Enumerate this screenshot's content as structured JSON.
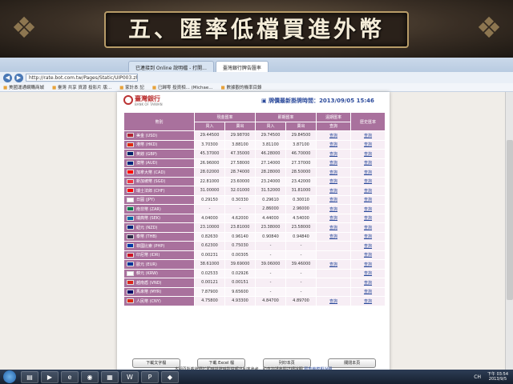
{
  "slide": {
    "title": "五、匯率低檔買進外幣"
  },
  "browser": {
    "tabs": [
      {
        "label": "已連接到 Online 說明檔 - 打開...",
        "active": false
      },
      {
        "label": "臺灣銀行牌告匯率",
        "active": true
      }
    ],
    "url": "http://rate.bot.com.tw/Pages/Static/UIP003.zh-TW.htm",
    "favorites": [
      "美國運通網購商城",
      "臺灣 共享 資源 投影片 版...",
      "家計本 記",
      "已歸零 投資相... (Michae...",
      "數據觀的機率目錄"
    ]
  },
  "page": {
    "bank_name": "臺灣銀行",
    "bank_name_en": "BANK OF TAIWAN",
    "quote_time_label": "牌價最新掛牌時間：",
    "quote_time": "2013/09/05 15:46",
    "headers": {
      "currency": "幣別",
      "cash": "現金匯率",
      "spot": "即期匯率",
      "forward": "遠期匯率",
      "history": "歷史匯率",
      "buy": "買入",
      "sell": "賣出",
      "forward_view": "查詢"
    },
    "rows": [
      {
        "name": "美金 (USD)",
        "flag": "us",
        "cash_buy": "29.44500",
        "cash_sell": "29.98700",
        "spot_buy": "29.74500",
        "spot_sell": "29.84500",
        "forward": "查詢",
        "history": "查詢"
      },
      {
        "name": "港幣 (HKD)",
        "flag": "hk",
        "cash_buy": "3.70300",
        "cash_sell": "3.88100",
        "spot_buy": "3.81100",
        "spot_sell": "3.87100",
        "forward": "查詢",
        "history": "查詢"
      },
      {
        "name": "英鎊 (GBP)",
        "flag": "gb",
        "cash_buy": "45.37000",
        "cash_sell": "47.35000",
        "spot_buy": "46.28000",
        "spot_sell": "46.70000",
        "forward": "查詢",
        "history": "查詢"
      },
      {
        "name": "澳幣 (AUD)",
        "flag": "au",
        "cash_buy": "26.96000",
        "cash_sell": "27.58000",
        "spot_buy": "27.14000",
        "spot_sell": "27.37000",
        "forward": "查詢",
        "history": "查詢"
      },
      {
        "name": "加拿大幣 (CAD)",
        "flag": "ca",
        "cash_buy": "28.02000",
        "cash_sell": "28.74000",
        "spot_buy": "28.28000",
        "spot_sell": "28.50000",
        "forward": "查詢",
        "history": "查詢"
      },
      {
        "name": "新加坡幣 (SGD)",
        "flag": "sg",
        "cash_buy": "22.81000",
        "cash_sell": "23.60000",
        "spot_buy": "23.24000",
        "spot_sell": "23.42000",
        "forward": "查詢",
        "history": "查詢"
      },
      {
        "name": "瑞士法郎 (CHF)",
        "flag": "ch",
        "cash_buy": "31.00000",
        "cash_sell": "32.01000",
        "spot_buy": "31.52000",
        "spot_sell": "31.81000",
        "forward": "查詢",
        "history": "查詢"
      },
      {
        "name": "日圓 (JPY)",
        "flag": "jp",
        "cash_buy": "0.29150",
        "cash_sell": "0.30330",
        "spot_buy": "0.29610",
        "spot_sell": "0.30010",
        "forward": "查詢",
        "history": "查詢"
      },
      {
        "name": "南非幣 (ZAR)",
        "flag": "za",
        "cash_buy": "-",
        "cash_sell": "-",
        "spot_buy": "2.86000",
        "spot_sell": "2.96000",
        "forward": "查詢",
        "history": "查詢"
      },
      {
        "name": "瑞典幣 (SEK)",
        "flag": "se",
        "cash_buy": "4.04000",
        "cash_sell": "4.62000",
        "spot_buy": "4.44000",
        "spot_sell": "4.54000",
        "forward": "查詢",
        "history": "查詢"
      },
      {
        "name": "紐元 (NZD)",
        "flag": "nz",
        "cash_buy": "23.10000",
        "cash_sell": "23.81000",
        "spot_buy": "23.38000",
        "spot_sell": "23.58000",
        "forward": "查詢",
        "history": "查詢"
      },
      {
        "name": "泰幣 (THB)",
        "flag": "th",
        "cash_buy": "0.82630",
        "cash_sell": "0.96140",
        "spot_buy": "0.90840",
        "spot_sell": "0.94840",
        "forward": "查詢",
        "history": "查詢"
      },
      {
        "name": "菲國比索 (PHP)",
        "flag": "ph",
        "cash_buy": "0.62300",
        "cash_sell": "0.75030",
        "spot_buy": "-",
        "spot_sell": "-",
        "forward": "",
        "history": "查詢"
      },
      {
        "name": "印尼幣 (IDR)",
        "flag": "id",
        "cash_buy": "0.00231",
        "cash_sell": "0.00305",
        "spot_buy": "-",
        "spot_sell": "-",
        "forward": "",
        "history": "查詢"
      },
      {
        "name": "歐元 (EUR)",
        "flag": "eu",
        "cash_buy": "38.61000",
        "cash_sell": "39.69000",
        "spot_buy": "39.06000",
        "spot_sell": "39.46000",
        "forward": "查詢",
        "history": "查詢"
      },
      {
        "name": "韓元 (KRW)",
        "flag": "kr",
        "cash_buy": "0.02533",
        "cash_sell": "0.02926",
        "spot_buy": "-",
        "spot_sell": "-",
        "forward": "",
        "history": "查詢"
      },
      {
        "name": "越南盾 (VND)",
        "flag": "vn",
        "cash_buy": "0.00121",
        "cash_sell": "0.00151",
        "spot_buy": "-",
        "spot_sell": "-",
        "forward": "",
        "history": "查詢"
      },
      {
        "name": "馬來幣 (MYR)",
        "flag": "my",
        "cash_buy": "7.87900",
        "cash_sell": "9.65600",
        "spot_buy": "-",
        "spot_sell": "-",
        "forward": "",
        "history": "查詢"
      },
      {
        "name": "人民幣 (CNY)",
        "flag": "cn",
        "cash_buy": "4.75800",
        "cash_sell": "4.93300",
        "spot_buy": "4.84700",
        "spot_sell": "4.89700",
        "forward": "查詢",
        "history": "查詢"
      }
    ],
    "buttons": {
      "download_text": "下載文字檔",
      "download_excel": "下載 Excel 檔",
      "print": "列印本頁",
      "close": "關閉本頁"
    },
    "note": "本網頁所載牌價於即時掛牌時所做報出利率參考，助查詢請參閱詳細說明",
    "note_link": "即表機模擬說明"
  },
  "taskbar": {
    "lang": "CH",
    "time": "下午 03:54",
    "date": "2013/9/5"
  },
  "flag_colors": {
    "us": "#b22234",
    "hk": "#de2910",
    "gb": "#012169",
    "au": "#00247d",
    "ca": "#ff0000",
    "sg": "#ef3340",
    "ch": "#ff0000",
    "jp": "#ffffff",
    "za": "#007a4d",
    "se": "#006aa7",
    "nz": "#00247d",
    "th": "#2d2a4a",
    "ph": "#0038a8",
    "id": "#ce1126",
    "eu": "#003399",
    "kr": "#ffffff",
    "vn": "#da251d",
    "my": "#010066",
    "cn": "#de2910"
  }
}
